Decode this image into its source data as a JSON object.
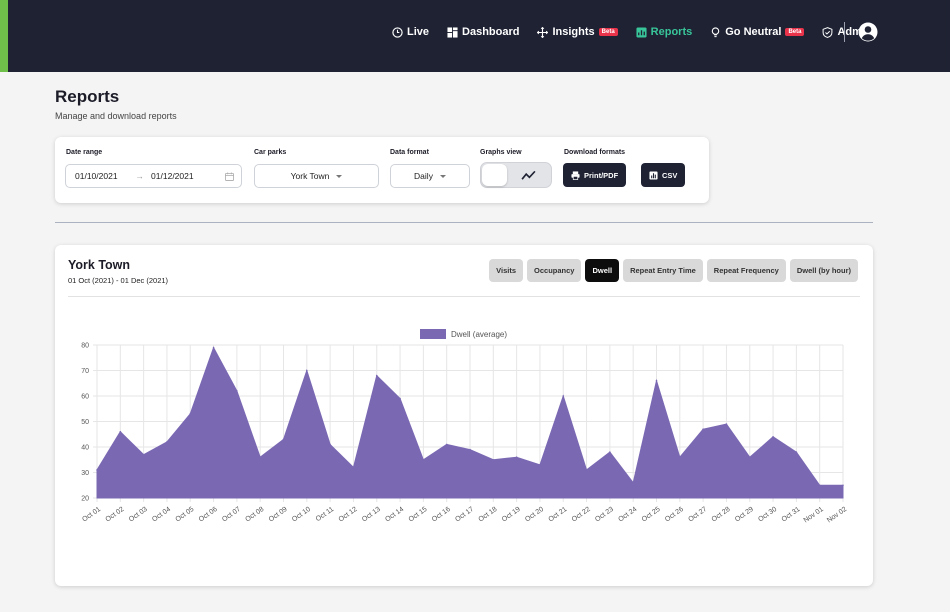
{
  "nav": {
    "items": [
      {
        "label": "Live",
        "icon": "clock-icon",
        "active": false,
        "beta": false
      },
      {
        "label": "Dashboard",
        "icon": "grid-icon",
        "active": false,
        "beta": false
      },
      {
        "label": "Insights",
        "icon": "move-icon",
        "active": false,
        "beta": true
      },
      {
        "label": "Reports",
        "icon": "report-icon",
        "active": true,
        "beta": false
      },
      {
        "label": "Go Neutral",
        "icon": "bulb-icon",
        "active": false,
        "beta": true
      },
      {
        "label": "Admin",
        "icon": "shield-icon",
        "active": false,
        "beta": false
      }
    ],
    "beta_label": "Beta",
    "active_color": "#39c59a"
  },
  "header": {
    "title": "Reports",
    "subtitle": "Manage and download reports"
  },
  "filters": {
    "date_range_label": "Date range",
    "date_from": "01/10/2021",
    "date_to": "01/12/2021",
    "car_parks_label": "Car parks",
    "car_park": "York Town",
    "data_format_label": "Data format",
    "data_format": "Daily",
    "graphs_view_label": "Graphs view",
    "download_label": "Download formats",
    "print_label": "Print/PDF",
    "csv_label": "CSV"
  },
  "report": {
    "title": "York Town",
    "subtitle": "01 Oct (2021) - 01 Dec (2021)",
    "tabs": [
      {
        "label": "Visits",
        "active": false
      },
      {
        "label": "Occupancy",
        "active": false
      },
      {
        "label": "Dwell",
        "active": true
      },
      {
        "label": "Repeat Entry Time",
        "active": false
      },
      {
        "label": "Repeat Frequency",
        "active": false
      },
      {
        "label": "Dwell (by hour)",
        "active": false
      }
    ]
  },
  "chart_data": {
    "type": "area",
    "legend": "Dwell (average)",
    "legend_position": "top-center",
    "color": "#7a68b3",
    "grid": true,
    "ylim": [
      20,
      80
    ],
    "yticks": [
      20,
      30,
      40,
      50,
      60,
      70,
      80
    ],
    "categories": [
      "Oct 01",
      "Oct 02",
      "Oct 03",
      "Oct 04",
      "Oct 05",
      "Oct 06",
      "Oct 07",
      "Oct 08",
      "Oct 09",
      "Oct 10",
      "Oct 11",
      "Oct 12",
      "Oct 13",
      "Oct 14",
      "Oct 15",
      "Oct 16",
      "Oct 17",
      "Oct 18",
      "Oct 19",
      "Oct 20",
      "Oct 21",
      "Oct 22",
      "Oct 23",
      "Oct 24",
      "Oct 25",
      "Oct 26",
      "Oct 27",
      "Oct 28",
      "Oct 29",
      "Oct 30",
      "Oct 31",
      "Nov 01",
      "Nov 02"
    ],
    "values": [
      31,
      46,
      37,
      42,
      53,
      79,
      62,
      36,
      43,
      70,
      41,
      32,
      68,
      59,
      35,
      41,
      39,
      35,
      36,
      33,
      60,
      31,
      38,
      26,
      66,
      36,
      47,
      49,
      36,
      44,
      38,
      25,
      25
    ]
  }
}
